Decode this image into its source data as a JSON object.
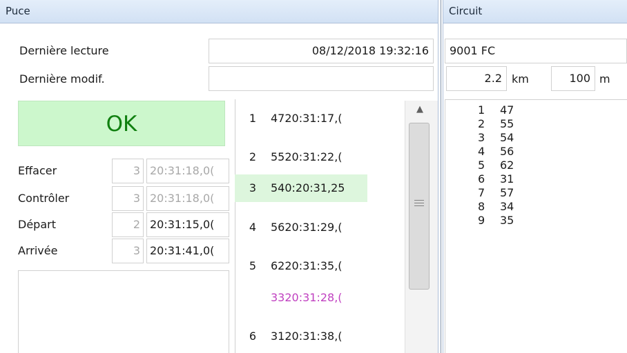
{
  "puce": {
    "title": "Puce",
    "derniere_lecture_label": "Dernière lecture",
    "derniere_lecture_value": "08/12/2018 19:32:16",
    "derniere_modif_label": "Dernière modif.",
    "derniere_modif_value": "",
    "status": "OK",
    "status_color": "#108010",
    "status_bg": "#ccf7cc",
    "rows": [
      {
        "label": "Effacer",
        "num": "3",
        "time": "20:31:18,0("
      },
      {
        "label": "Contrôler",
        "num": "3",
        "time": "20:31:18,0("
      },
      {
        "label": "Départ",
        "num": "2",
        "time": "20:31:15,0("
      },
      {
        "label": "Arrivée",
        "num": "3",
        "time": "20:31:41,0("
      }
    ]
  },
  "punches": [
    {
      "n": "1",
      "text": "4720:31:17,(",
      "style": "normal"
    },
    {
      "n": "2",
      "text": "5520:31:22,(",
      "style": "normal"
    },
    {
      "n": "3",
      "text": "540:20:31,25",
      "style": "highlight"
    },
    {
      "n": "4",
      "text": "5620:31:29,(",
      "style": "normal"
    },
    {
      "n": "5",
      "text": "6220:31:35,(",
      "style": "normal"
    },
    {
      "n": "",
      "text": "3320:31:28,(",
      "style": "extra"
    },
    {
      "n": "6",
      "text": "3120:31:38,(",
      "style": "normal"
    }
  ],
  "scrollbar": {
    "grip_icon": "grip-lines-icon",
    "up_icon": "arrow-up-icon"
  },
  "colors": {
    "highlight_bg": "#ddf6dd",
    "extra_text": "#c040c0"
  },
  "circuit": {
    "title": "Circuit",
    "name": "9001 FC",
    "distance": "2.2",
    "distance_unit": "km",
    "climb": "100",
    "climb_unit": "m",
    "controls": [
      {
        "n": "1",
        "code": "47"
      },
      {
        "n": "2",
        "code": "55"
      },
      {
        "n": "3",
        "code": "54"
      },
      {
        "n": "4",
        "code": "56"
      },
      {
        "n": "5",
        "code": "62"
      },
      {
        "n": "6",
        "code": "31"
      },
      {
        "n": "7",
        "code": "57"
      },
      {
        "n": "8",
        "code": "34"
      },
      {
        "n": "9",
        "code": "35"
      }
    ]
  }
}
